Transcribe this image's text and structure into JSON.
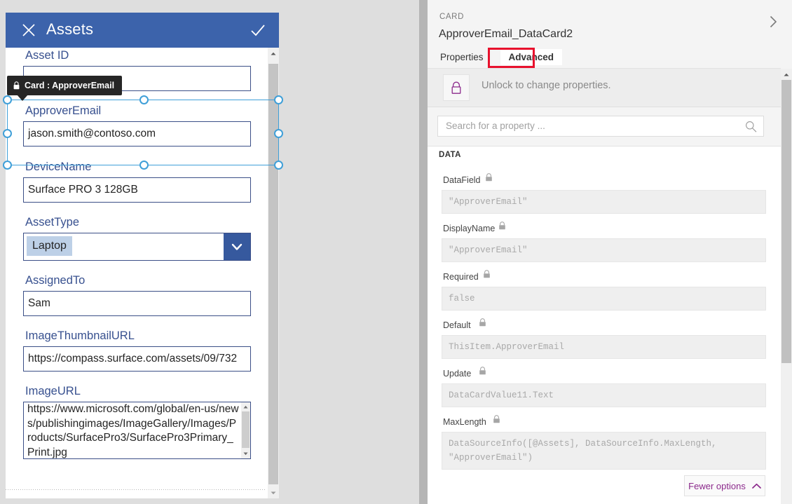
{
  "app": {
    "header": {
      "title": "Assets",
      "close_icon": "close-x-icon",
      "confirm_icon": "checkmark-icon"
    },
    "fields": [
      {
        "label": "Asset ID",
        "value": "",
        "type": "text"
      },
      {
        "label": "ApproverEmail",
        "value": "jason.smith@contoso.com",
        "type": "text"
      },
      {
        "label": "DeviceName",
        "value": "Surface PRO 3 128GB",
        "type": "text"
      },
      {
        "label": "AssetType",
        "value": "Laptop",
        "type": "dropdown"
      },
      {
        "label": "AssignedTo",
        "value": "Sam",
        "type": "text"
      },
      {
        "label": "ImageThumbnailURL",
        "value": "https://compass.surface.com/assets/09/732",
        "type": "text"
      },
      {
        "label": "ImageURL",
        "value": "https://www.microsoft.com/global/en-us/news/publishingimages/ImageGallery/Images/Products/SurfacePro3/SurfacePro3Primary_Print.jpg",
        "type": "textarea"
      }
    ],
    "selection_tooltip": {
      "text": "Card : ApproverEmail",
      "lock_icon": "lock-icon"
    }
  },
  "pane": {
    "kicker": "CARD",
    "control_name": "ApproverEmail_DataCard2",
    "collapse_icon": "chevron-right-icon",
    "tabs": [
      {
        "label": "Properties",
        "active": false
      },
      {
        "label": "Advanced",
        "active": true
      }
    ],
    "unlock": {
      "message": "Unlock to change properties.",
      "lock_icon": "lock-icon"
    },
    "search": {
      "placeholder": "Search for a property ...",
      "value": "",
      "icon": "search-icon"
    },
    "section_title": "DATA",
    "properties": [
      {
        "label": "DataField",
        "value": "\"ApproverEmail\"",
        "locked": true
      },
      {
        "label": "DisplayName",
        "value": "\"ApproverEmail\"",
        "locked": true
      },
      {
        "label": "Required",
        "value": "false",
        "locked": true
      },
      {
        "label": "Default",
        "value": "ThisItem.ApproverEmail",
        "locked": true
      },
      {
        "label": "Update",
        "value": "DataCardValue11.Text",
        "locked": true
      },
      {
        "label": "MaxLength",
        "value": "DataSourceInfo([@Assets], DataSourceInfo.MaxLength,\n\"ApproverEmail\")",
        "locked": true
      }
    ],
    "fewer_options": {
      "label": "Fewer options",
      "icon": "chevron-up-icon"
    }
  },
  "annotation": {
    "highlight_target": "Advanced",
    "color": "#e8112d"
  },
  "colors": {
    "header_blue": "#3c63ab",
    "label_blue": "#37508f",
    "input_border": "#3b4f87",
    "selection": "#3f9fd8",
    "canvas_gray": "#dedede",
    "accent_purple": "#8c2a8c"
  }
}
